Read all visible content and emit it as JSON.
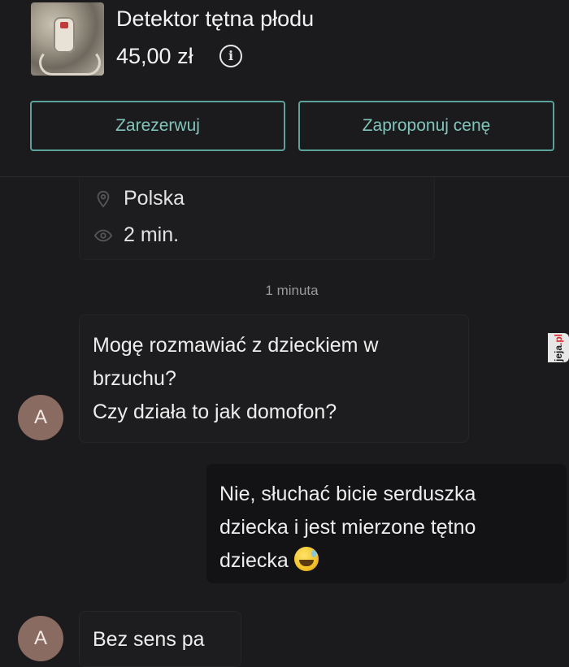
{
  "listing": {
    "title": "Detektor tętna płodu",
    "price": "45,00 zł",
    "info_icon": "info-circle-icon",
    "buttons": {
      "reserve": "Zarezerwuj",
      "offer": "Zaproponuj cenę"
    }
  },
  "meta": {
    "location": "Polska",
    "location_icon": "location-pin-icon",
    "seen": "2 min.",
    "seen_icon": "eye-icon"
  },
  "chat": {
    "timestamp": "1 minuta",
    "avatar_letter": "A",
    "messages": [
      {
        "from": "other",
        "lines": [
          "Mogę rozmawiać z dzieckiem w",
          "brzuchu?",
          "Czy działa to jak domofon?"
        ]
      },
      {
        "from": "me",
        "lines": [
          "Nie, słuchać bicie serduszka",
          "dziecka i jest mierzone tętno",
          "dziecka"
        ],
        "emoji": "grinning-sweat-emoji"
      },
      {
        "from": "other",
        "lines": [
          "Bez sens pa"
        ]
      }
    ]
  },
  "watermark": {
    "prefix": "jeja",
    "suffix": ".pl"
  },
  "colors": {
    "background": "#1b1b1d",
    "accent": "#5aa39a",
    "avatar": "#8a6b62"
  }
}
